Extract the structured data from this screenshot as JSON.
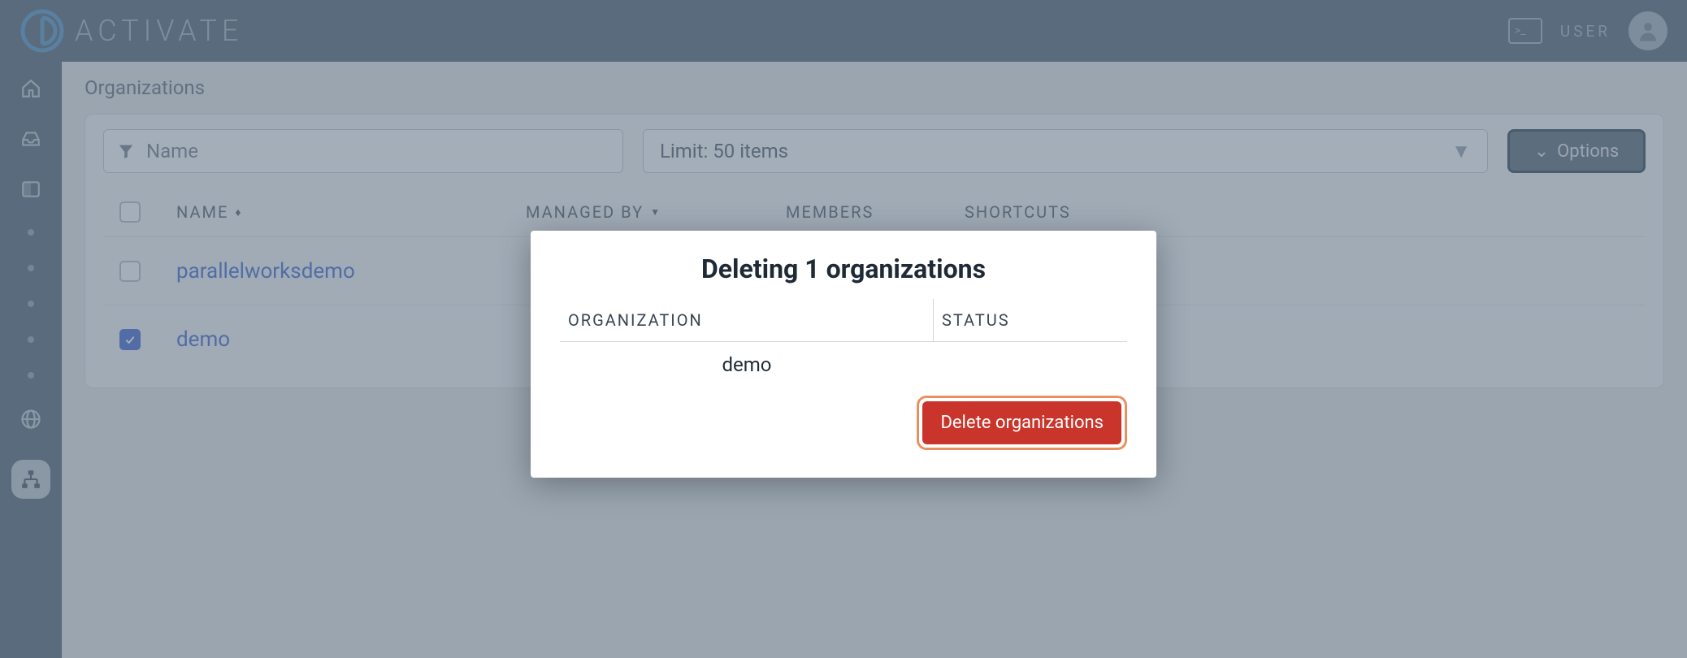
{
  "brand": {
    "name": "ACTIVATE"
  },
  "header": {
    "user_label": "USER"
  },
  "page": {
    "title": "Organizations"
  },
  "filters": {
    "name_placeholder": "Name",
    "limit_label": "Limit: 50 items",
    "options_label": "Options"
  },
  "table": {
    "headers": {
      "name": "NAME",
      "managed_by": "MANAGED BY",
      "members": "MEMBERS",
      "shortcuts": "SHORTCUTS"
    },
    "rows": [
      {
        "name": "parallelworksdemo",
        "checked": false
      },
      {
        "name": "demo",
        "checked": true
      }
    ]
  },
  "modal": {
    "title": "Deleting 1 organizations",
    "headers": {
      "organization": "ORGANIZATION",
      "status": "STATUS"
    },
    "rows": [
      {
        "organization": "demo",
        "status": ""
      }
    ],
    "delete_label": "Delete organizations"
  }
}
